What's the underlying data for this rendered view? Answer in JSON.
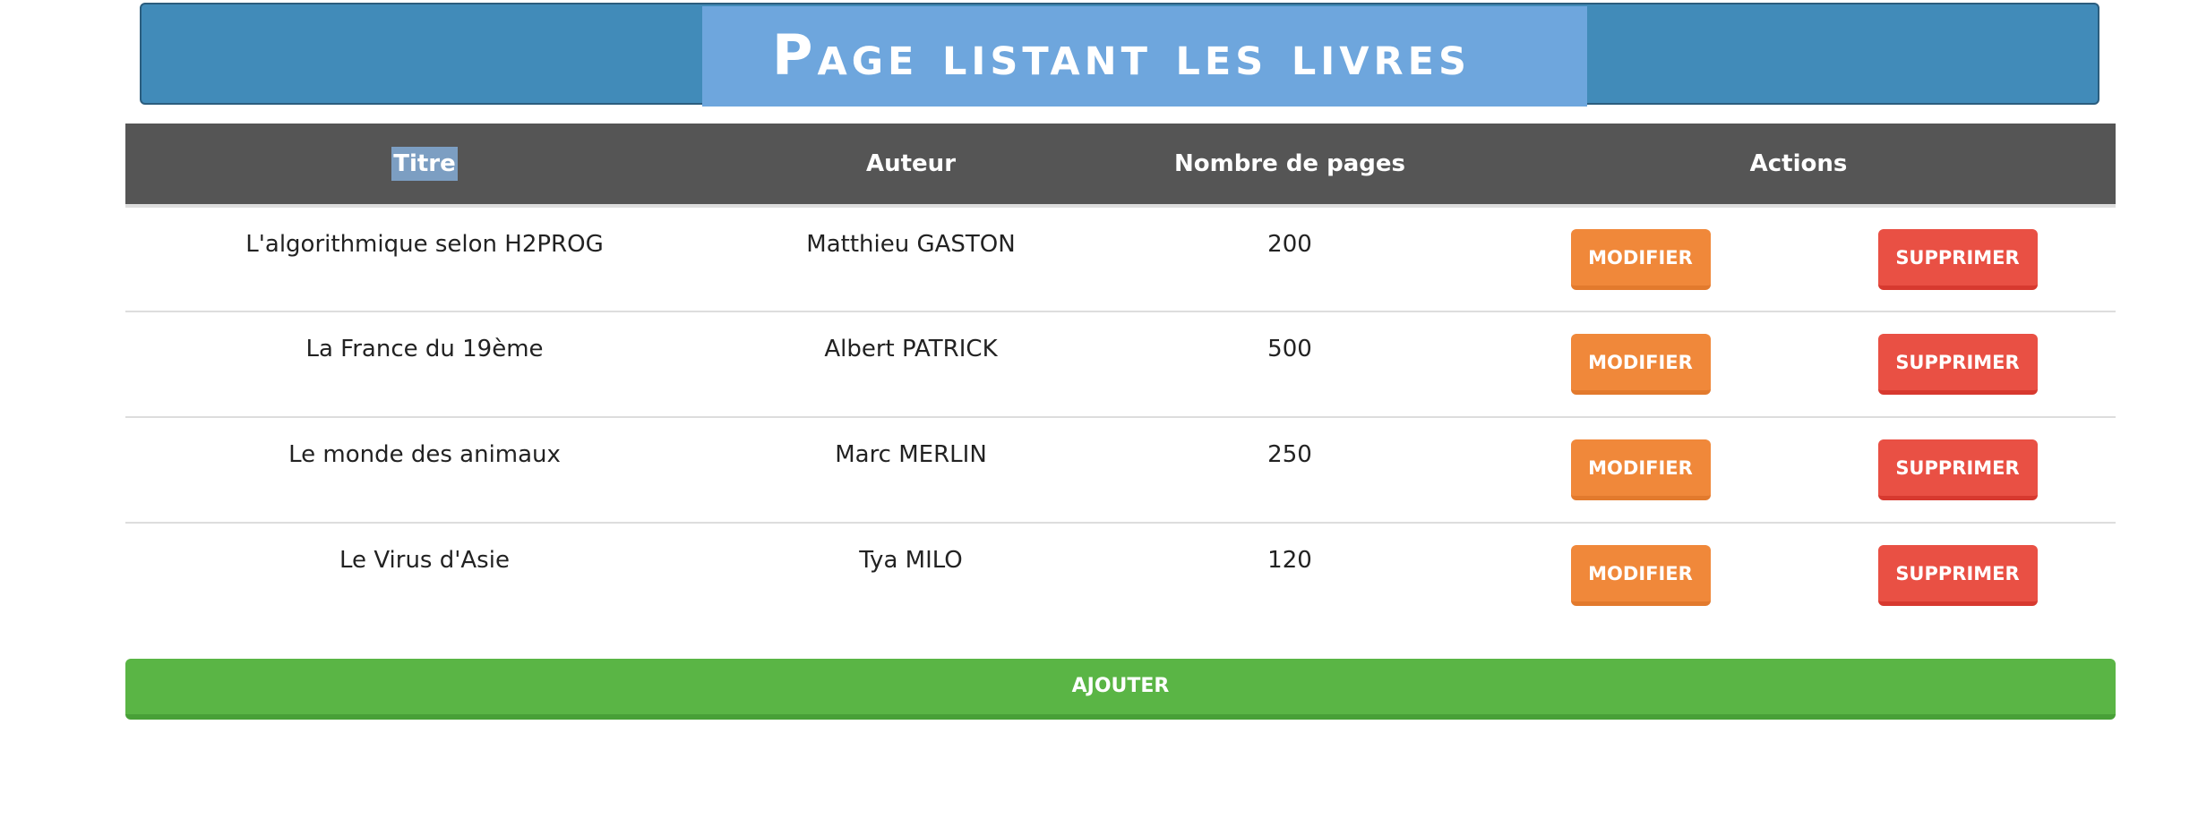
{
  "banner": {
    "title": "Page listant les livres"
  },
  "table": {
    "headers": {
      "title": "Titre",
      "author": "Auteur",
      "pages": "Nombre de pages",
      "actions": "Actions"
    },
    "rows": [
      {
        "title": "L'algorithmique selon H2PROG",
        "author": "Matthieu GASTON",
        "pages": "200"
      },
      {
        "title": "La France du 19ème",
        "author": "Albert PATRICK",
        "pages": "500"
      },
      {
        "title": "Le monde des animaux",
        "author": "Marc MERLIN",
        "pages": "250"
      },
      {
        "title": "Le Virus d'Asie",
        "author": "Tya MILO",
        "pages": "120"
      }
    ]
  },
  "actions": {
    "edit_label": "Modifier",
    "delete_label": "Supprimer",
    "add_label": "Ajouter"
  },
  "colors": {
    "banner": "#418bb9",
    "table_header": "#555555",
    "edit_button": "#f0883a",
    "delete_button": "#e95044",
    "add_button": "#5ab545"
  }
}
